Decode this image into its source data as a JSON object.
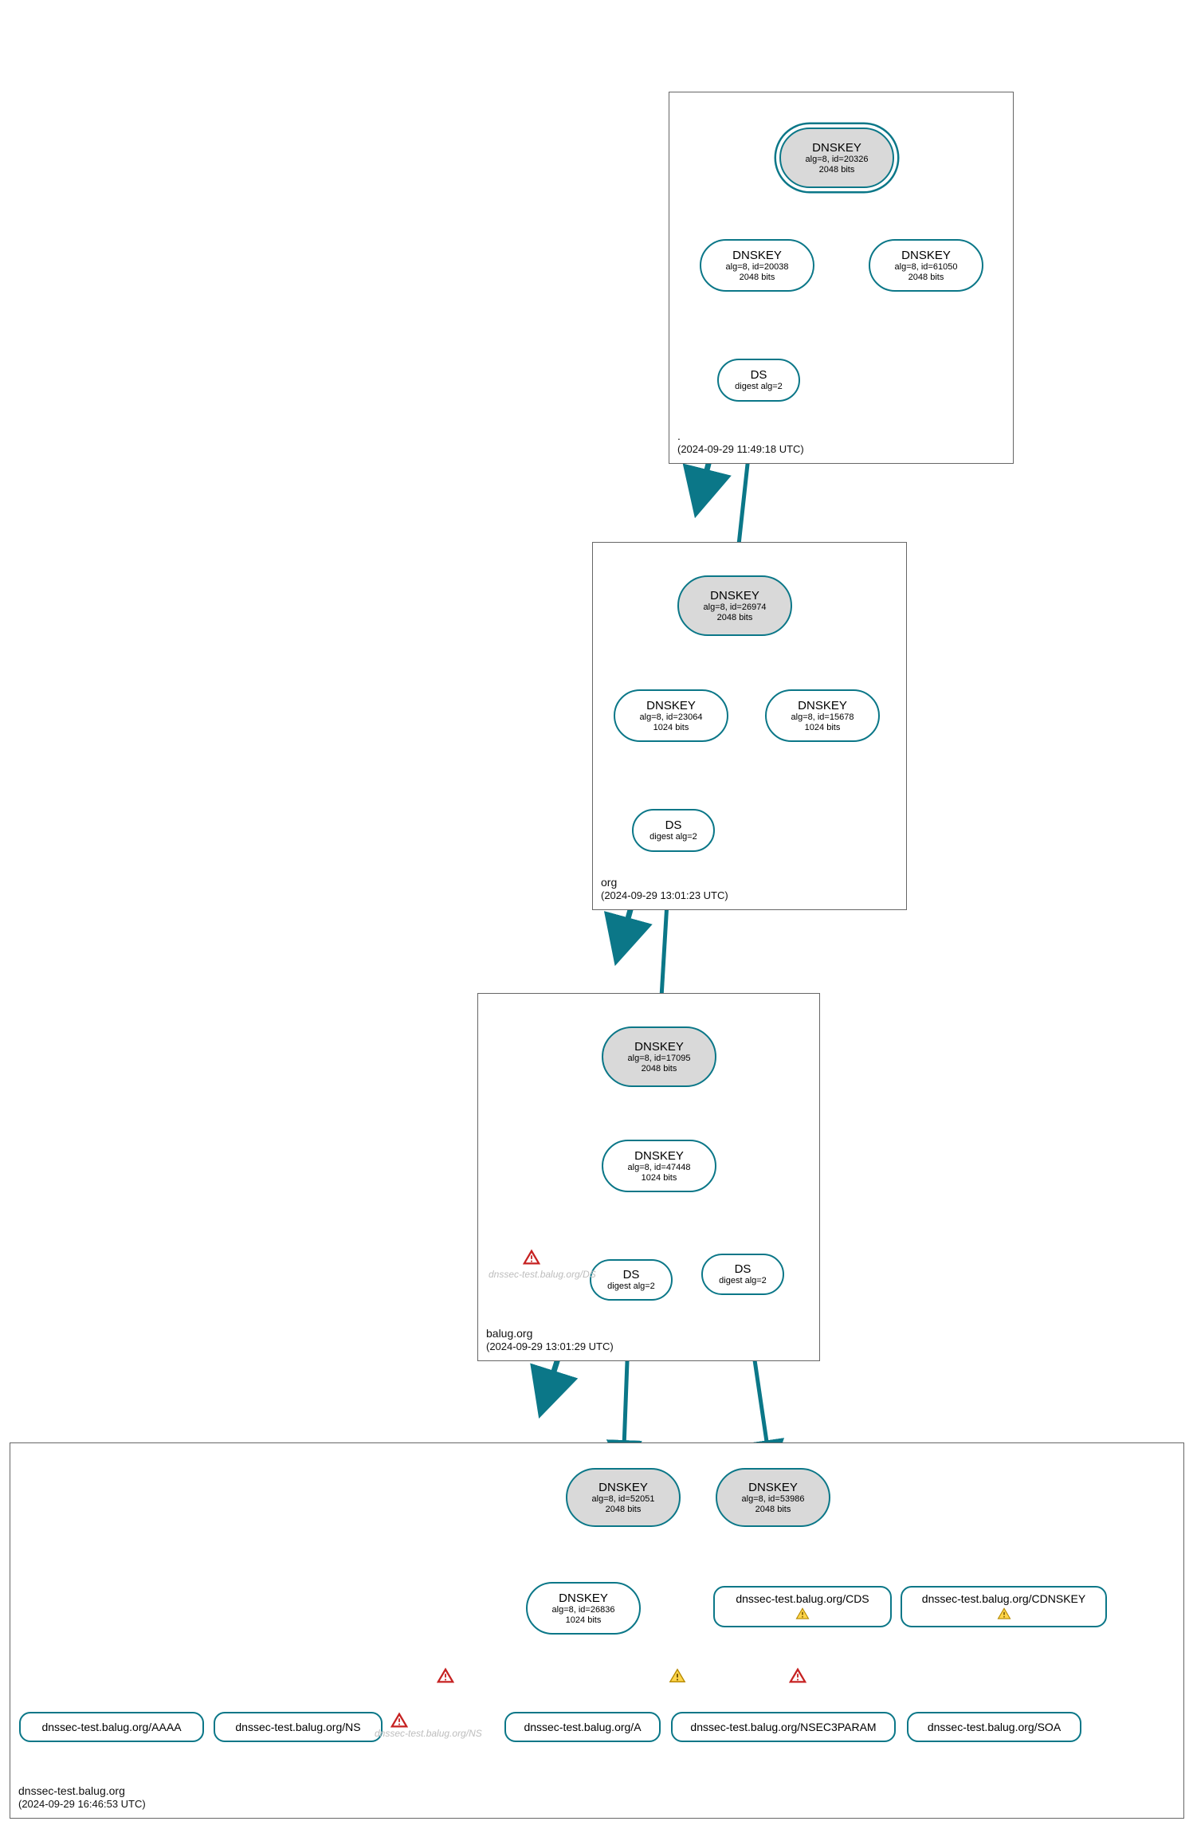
{
  "zones": {
    "root": {
      "name": ".",
      "timestamp": "(2024-09-29 11:49:18 UTC)"
    },
    "org": {
      "name": "org",
      "timestamp": "(2024-09-29 13:01:23 UTC)"
    },
    "balug": {
      "name": "balug.org",
      "timestamp": "(2024-09-29 13:01:29 UTC)"
    },
    "dnssec": {
      "name": "dnssec-test.balug.org",
      "timestamp": "(2024-09-29 16:46:53 UTC)"
    }
  },
  "nodes": {
    "root_ksk": {
      "t1": "DNSKEY",
      "t2": "alg=8, id=20326",
      "t3": "2048 bits"
    },
    "root_zsk1": {
      "t1": "DNSKEY",
      "t2": "alg=8, id=20038",
      "t3": "2048 bits"
    },
    "root_zsk2": {
      "t1": "DNSKEY",
      "t2": "alg=8, id=61050",
      "t3": "2048 bits"
    },
    "root_ds": {
      "t1": "DS",
      "t2": "digest alg=2"
    },
    "org_ksk": {
      "t1": "DNSKEY",
      "t2": "alg=8, id=26974",
      "t3": "2048 bits"
    },
    "org_zsk1": {
      "t1": "DNSKEY",
      "t2": "alg=8, id=23064",
      "t3": "1024 bits"
    },
    "org_zsk2": {
      "t1": "DNSKEY",
      "t2": "alg=8, id=15678",
      "t3": "1024 bits"
    },
    "org_ds": {
      "t1": "DS",
      "t2": "digest alg=2"
    },
    "balug_ksk": {
      "t1": "DNSKEY",
      "t2": "alg=8, id=17095",
      "t3": "2048 bits"
    },
    "balug_zsk": {
      "t1": "DNSKEY",
      "t2": "alg=8, id=47448",
      "t3": "1024 bits"
    },
    "balug_ds1": {
      "t1": "DS",
      "t2": "digest alg=2"
    },
    "balug_ds2": {
      "t1": "DS",
      "t2": "digest alg=2"
    },
    "dt_ksk1": {
      "t1": "DNSKEY",
      "t2": "alg=8, id=52051",
      "t3": "2048 bits"
    },
    "dt_ksk2": {
      "t1": "DNSKEY",
      "t2": "alg=8, id=53986",
      "t3": "2048 bits"
    },
    "dt_zsk": {
      "t1": "DNSKEY",
      "t2": "alg=8, id=26836",
      "t3": "1024 bits"
    }
  },
  "rr": {
    "cds": "dnssec-test.balug.org/CDS",
    "cdnskey": "dnssec-test.balug.org/CDNSKEY",
    "aaaa": "dnssec-test.balug.org/AAAA",
    "ns": "dnssec-test.balug.org/NS",
    "a": "dnssec-test.balug.org/A",
    "nsec3": "dnssec-test.balug.org/NSEC3PARAM",
    "soa": "dnssec-test.balug.org/SOA"
  },
  "grey": {
    "balug_ds": "dnssec-test.balug.org/DS",
    "dt_ns": "dnssec-test.balug.org/NS"
  },
  "chart_data": {
    "type": "diagram",
    "description": "DNSSEC delegation / authentication chain from root zone down to dnssec-test.balug.org, rendered as nested zone boxes with DNSKEY/DS ellipse nodes and RRset leaf boxes. Teal arrows indicate RRSIG validation / delegation relationships; red and yellow triangle icons mark errors and warnings respectively.",
    "zones": [
      {
        "name": ".",
        "timestamp": "2024-09-29 11:49:18 UTC",
        "dnskeys": [
          {
            "role": "KSK",
            "alg": 8,
            "id": 20326,
            "bits": 2048,
            "trust_anchor": true
          },
          {
            "role": "ZSK",
            "alg": 8,
            "id": 20038,
            "bits": 2048
          },
          {
            "role": "ZSK",
            "alg": 8,
            "id": 61050,
            "bits": 2048
          }
        ],
        "ds": [
          {
            "digest_alg": 2,
            "for_zone": "org"
          }
        ]
      },
      {
        "name": "org",
        "timestamp": "2024-09-29 13:01:23 UTC",
        "dnskeys": [
          {
            "role": "KSK",
            "alg": 8,
            "id": 26974,
            "bits": 2048
          },
          {
            "role": "ZSK",
            "alg": 8,
            "id": 23064,
            "bits": 1024
          },
          {
            "role": "ZSK",
            "alg": 8,
            "id": 15678,
            "bits": 1024
          }
        ],
        "ds": [
          {
            "digest_alg": 2,
            "for_zone": "balug.org"
          }
        ]
      },
      {
        "name": "balug.org",
        "timestamp": "2024-09-29 13:01:29 UTC",
        "dnskeys": [
          {
            "role": "KSK",
            "alg": 8,
            "id": 17095,
            "bits": 2048
          },
          {
            "role": "ZSK",
            "alg": 8,
            "id": 47448,
            "bits": 1024
          }
        ],
        "ds": [
          {
            "digest_alg": 2,
            "for_zone": "dnssec-test.balug.org"
          },
          {
            "digest_alg": 2,
            "for_zone": "dnssec-test.balug.org"
          }
        ],
        "missing": [
          {
            "rrset": "dnssec-test.balug.org/DS",
            "status": "error"
          }
        ]
      },
      {
        "name": "dnssec-test.balug.org",
        "timestamp": "2024-09-29 16:46:53 UTC",
        "dnskeys": [
          {
            "role": "KSK",
            "alg": 8,
            "id": 52051,
            "bits": 2048
          },
          {
            "role": "KSK",
            "alg": 8,
            "id": 53986,
            "bits": 2048
          },
          {
            "role": "ZSK",
            "alg": 8,
            "id": 26836,
            "bits": 1024
          }
        ],
        "rrsets": [
          {
            "name": "dnssec-test.balug.org/CDS",
            "status": "warning"
          },
          {
            "name": "dnssec-test.balug.org/CDNSKEY",
            "status": "warning"
          },
          {
            "name": "dnssec-test.balug.org/AAAA",
            "status": "ok"
          },
          {
            "name": "dnssec-test.balug.org/NS",
            "status": "ok"
          },
          {
            "name": "dnssec-test.balug.org/A",
            "status": "ok"
          },
          {
            "name": "dnssec-test.balug.org/NSEC3PARAM",
            "status": "ok"
          },
          {
            "name": "dnssec-test.balug.org/SOA",
            "status": "ok"
          }
        ],
        "missing": [
          {
            "rrset": "dnssec-test.balug.org/NS",
            "status": "error"
          }
        ],
        "edge_markers": [
          {
            "near": "dnssec-test.balug.org/NS",
            "status": "error"
          },
          {
            "near": "dnssec-test.balug.org/A",
            "status": "warning"
          },
          {
            "near": "dnssec-test.balug.org/NSEC3PARAM",
            "status": "error"
          }
        ]
      }
    ],
    "edges": [
      {
        "from": "root KSK 20326",
        "to": "root KSK 20326",
        "type": "self-sig"
      },
      {
        "from": "root KSK 20326",
        "to": "root ZSK 20038"
      },
      {
        "from": "root KSK 20326",
        "to": "root ZSK 61050"
      },
      {
        "from": "root ZSK 20038",
        "to": "DS(org)"
      },
      {
        "from": "DS(org)",
        "to": "org KSK 26974"
      },
      {
        "from": "org KSK 26974",
        "to": "org KSK 26974",
        "type": "self-sig"
      },
      {
        "from": "org KSK 26974",
        "to": "org ZSK 23064"
      },
      {
        "from": "org KSK 26974",
        "to": "org ZSK 15678"
      },
      {
        "from": "org ZSK 23064",
        "to": "DS(balug.org)"
      },
      {
        "from": "DS(balug.org)",
        "to": "balug KSK 17095"
      },
      {
        "from": "balug KSK 17095",
        "to": "balug KSK 17095",
        "type": "self-sig"
      },
      {
        "from": "balug KSK 17095",
        "to": "balug ZSK 47448"
      },
      {
        "from": "balug ZSK 47448",
        "to": "DS#1"
      },
      {
        "from": "balug ZSK 47448",
        "to": "DS#2"
      },
      {
        "from": "DS#1",
        "to": "dt KSK 52051"
      },
      {
        "from": "DS#2",
        "to": "dt KSK 53986"
      },
      {
        "from": "dt KSK 52051",
        "to": "dt KSK 52051",
        "type": "self-sig"
      },
      {
        "from": "dt KSK 52051",
        "to": "dt ZSK 26836"
      },
      {
        "from": "dt KSK 52051",
        "to": "CDS"
      },
      {
        "from": "dt KSK 52051",
        "to": "CDNSKEY"
      },
      {
        "from": "dt KSK 53986",
        "to": "dt KSK 53986",
        "type": "self-sig"
      },
      {
        "from": "dt KSK 53986",
        "to": "dt ZSK 26836"
      },
      {
        "from": "dt KSK 53986",
        "to": "CDS"
      },
      {
        "from": "dt KSK 53986",
        "to": "CDNSKEY"
      },
      {
        "from": "dt ZSK 26836",
        "to": "AAAA"
      },
      {
        "from": "dt ZSK 26836",
        "to": "NS"
      },
      {
        "from": "dt ZSK 26836",
        "to": "A"
      },
      {
        "from": "dt ZSK 26836",
        "to": "NSEC3PARAM"
      },
      {
        "from": "dt ZSK 26836",
        "to": "SOA"
      }
    ]
  }
}
